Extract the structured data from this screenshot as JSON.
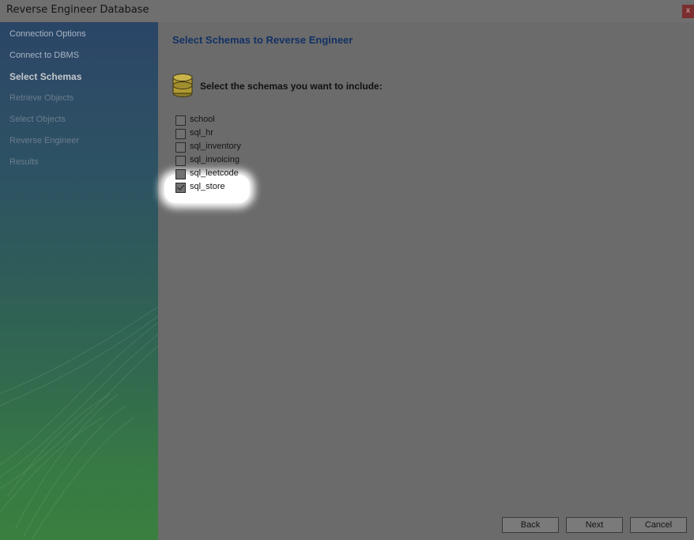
{
  "window": {
    "title": "Reverse Engineer Database",
    "close_label": "x"
  },
  "steps": [
    {
      "label": "Connection Options",
      "state": "done"
    },
    {
      "label": "Connect to DBMS",
      "state": "done"
    },
    {
      "label": "Select Schemas",
      "state": "current"
    },
    {
      "label": "Retrieve Objects",
      "state": "future"
    },
    {
      "label": "Select Objects",
      "state": "future"
    },
    {
      "label": "Reverse Engineer",
      "state": "future"
    },
    {
      "label": "Results",
      "state": "future"
    }
  ],
  "main": {
    "title": "Select Schemas to Reverse Engineer",
    "icon": "database-icon",
    "instruction": "Select the schemas you want to include:",
    "schemas": [
      {
        "name": "school",
        "checked": false
      },
      {
        "name": "sql_hr",
        "checked": false
      },
      {
        "name": "sql_inventory",
        "checked": false
      },
      {
        "name": "sql_invoicing",
        "checked": false
      },
      {
        "name": "sql_leetcode",
        "checked": false
      },
      {
        "name": "sql_store",
        "checked": true
      }
    ]
  },
  "buttons": {
    "back": "Back",
    "next": "Next",
    "cancel": "Cancel"
  },
  "colors": {
    "title_blue": "#123164",
    "close_red": "#7a2e2e",
    "sidebar_top": "#2a4566",
    "sidebar_bottom": "#3a7f40"
  }
}
